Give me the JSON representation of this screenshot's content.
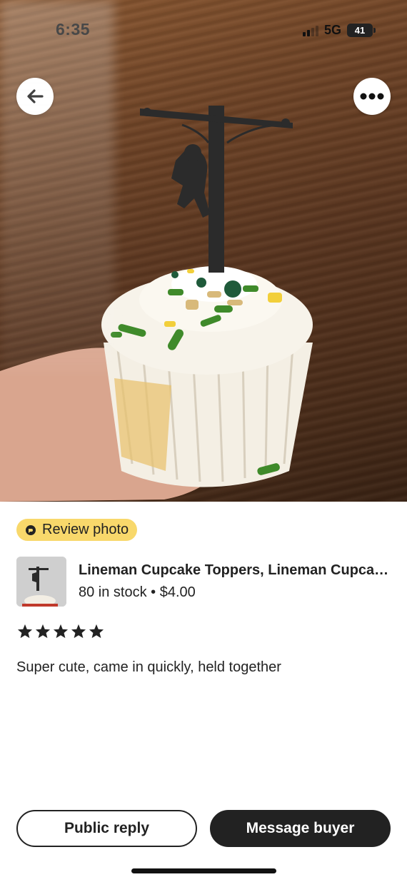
{
  "status_bar": {
    "time": "6:35",
    "network": "5G",
    "battery": "41"
  },
  "header": {
    "back_icon": "arrow-left-icon",
    "more_icon": "more-horizontal-icon"
  },
  "review": {
    "badge_label": "Review photo",
    "badge_icon": "review-photo-icon",
    "rating": 5,
    "rating_max": 5,
    "text": "Super cute, came in quickly, held together"
  },
  "product": {
    "title": "Lineman Cupcake Toppers, Lineman Cupcake Toppers",
    "meta": "80 in stock • $4.00"
  },
  "actions": {
    "public_reply_label": "Public reply",
    "message_buyer_label": "Message buyer"
  },
  "colors": {
    "badge": "#f8d86b",
    "dark": "#222222",
    "white": "#ffffff"
  }
}
